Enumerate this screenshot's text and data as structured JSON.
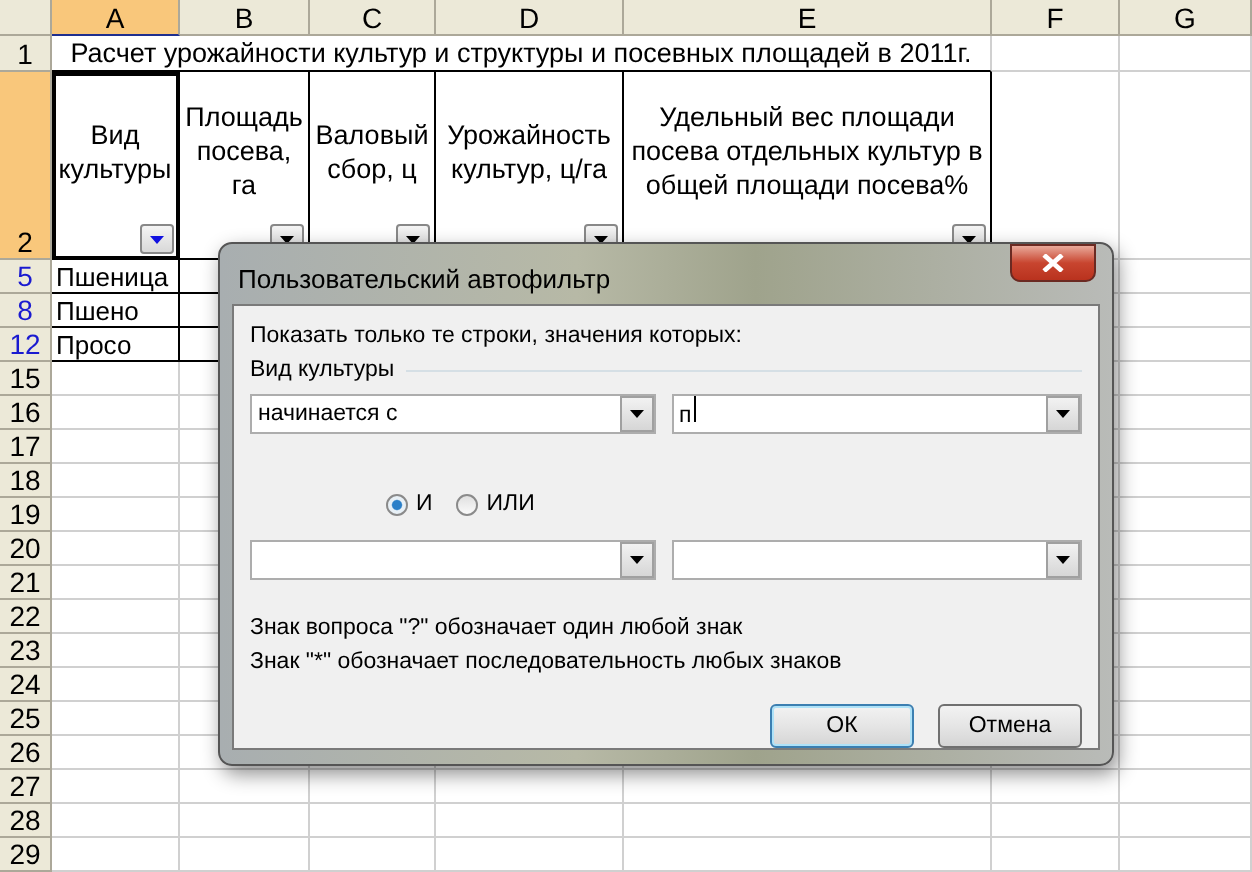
{
  "sheet": {
    "columns": [
      {
        "label": "A",
        "selected": true
      },
      {
        "label": "B",
        "selected": false
      },
      {
        "label": "C",
        "selected": false
      },
      {
        "label": "D",
        "selected": false
      },
      {
        "label": "E",
        "selected": false
      },
      {
        "label": "F",
        "selected": false
      },
      {
        "label": "G",
        "selected": false
      }
    ],
    "title_row": {
      "number": "1",
      "text": "Расчет урожайности культур и структуры и посевных площадей в 2011г."
    },
    "header_row": {
      "number": "2",
      "selected": true,
      "cells": [
        {
          "text": "Вид культуры",
          "filter_active": true
        },
        {
          "text": "Площадь посева, га",
          "filter_active": false
        },
        {
          "text": "Валовый сбор, ц",
          "filter_active": false
        },
        {
          "text": "Урожайность культур, ц/га",
          "filter_active": false
        },
        {
          "text": "Удельный вес площади посева отдельных культур в общей площади посева%",
          "filter_active": false
        }
      ]
    },
    "rows": [
      {
        "number": "5",
        "filtered": true,
        "crop": "Пшеница"
      },
      {
        "number": "8",
        "filtered": true,
        "crop": "Пшено"
      },
      {
        "number": "12",
        "filtered": true,
        "crop": "Просо"
      },
      {
        "number": "15",
        "filtered": false
      },
      {
        "number": "16",
        "filtered": false
      },
      {
        "number": "17",
        "filtered": false
      },
      {
        "number": "18",
        "filtered": false
      },
      {
        "number": "19",
        "filtered": false
      },
      {
        "number": "20",
        "filtered": false
      },
      {
        "number": "21",
        "filtered": false
      },
      {
        "number": "22",
        "filtered": false
      },
      {
        "number": "23",
        "filtered": false
      },
      {
        "number": "24",
        "filtered": false
      },
      {
        "number": "25",
        "filtered": false
      },
      {
        "number": "26",
        "filtered": false
      },
      {
        "number": "27",
        "filtered": false
      },
      {
        "number": "28",
        "filtered": false
      },
      {
        "number": "29",
        "filtered": false
      }
    ]
  },
  "dialog": {
    "title": "Пользовательский автофильтр",
    "prompt": "Показать только те строки, значения которых:",
    "field_label": "Вид культуры",
    "condition_1": {
      "operator": "начинается с",
      "value": "п"
    },
    "logic": [
      {
        "label": "И",
        "selected": true
      },
      {
        "label": "ИЛИ",
        "selected": false
      }
    ],
    "hints": [
      "Знак вопроса \"?\" обозначает один любой знак",
      "Знак \"*\" обозначает последовательность любых знаков"
    ],
    "buttons": [
      {
        "label": "ОК",
        "default": true
      },
      {
        "label": "Отмена",
        "default": false
      }
    ]
  }
}
